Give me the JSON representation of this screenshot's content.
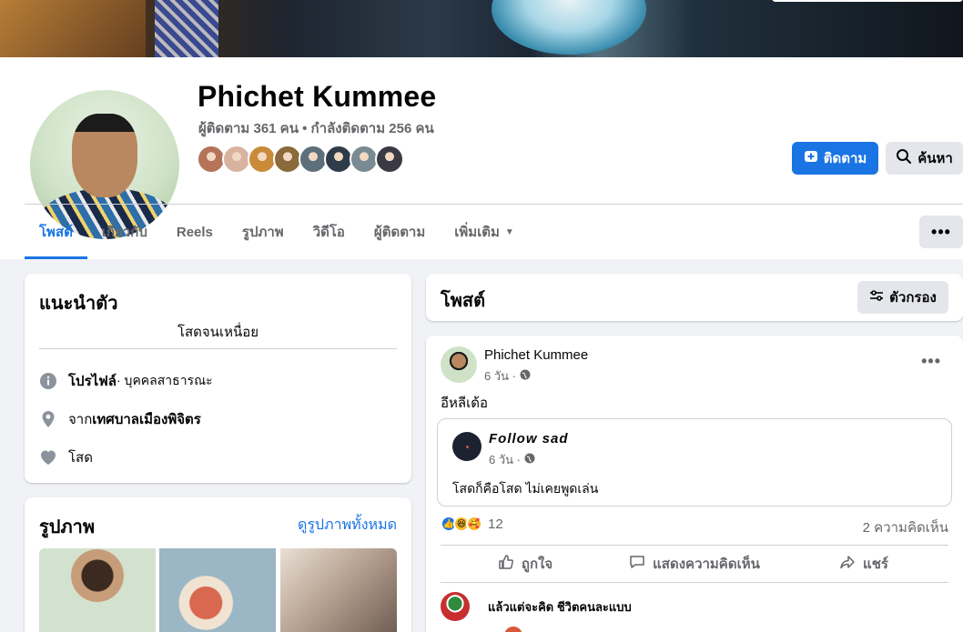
{
  "profile": {
    "name": "Phichet Kummee",
    "follow_stats": "ผู้ติดตาม 361 คน • กำลังติดตาม 256 คน",
    "friend_avatar_colors": [
      "#b5735a",
      "#d7b3a0",
      "#c98a3a",
      "#8a6a3a",
      "#5c6f7a",
      "#2e3c4a",
      "#7a8a92",
      "#3a3a44"
    ]
  },
  "header_buttons": {
    "follow_label": "ติดตาม",
    "search_label": "ค้นหา"
  },
  "tabs": [
    {
      "label": "โพสต์",
      "active": true
    },
    {
      "label": "เกี่ยวกับ"
    },
    {
      "label": "Reels"
    },
    {
      "label": "รูปภาพ"
    },
    {
      "label": "วิดีโอ"
    },
    {
      "label": "ผู้ติดตาม"
    },
    {
      "label": "เพิ่มเติม"
    }
  ],
  "intro": {
    "title": "แนะนำตัว",
    "bio": "โสดจนเหนื่อย",
    "profile_label": "โปรไฟล์",
    "profile_type": " · บุคคลสาธารณะ",
    "from_prefix": "จาก ",
    "hometown": "เทศบาลเมืองพิจิตร",
    "relationship": "โสด"
  },
  "photos": {
    "title": "รูปภาพ",
    "see_all": "ดูรูปภาพทั้งหมด"
  },
  "posts_section": {
    "title": "โพสต์",
    "filter_label": "ตัวกรอง"
  },
  "post": {
    "author": "Phichet Kummee",
    "time": "6 วัน ·",
    "text": "อีหลีเด้อ",
    "shared": {
      "author": "Follow sad",
      "time": "6 วัน ·",
      "text": "โสดก็คือโสด ไม่เคยพูดเล่น"
    },
    "reaction_count": "12",
    "comment_count": "2 ความคิดเห็น",
    "actions": {
      "like": "ถูกใจ",
      "comment": "แสดงความคิดเห็น",
      "share": "แชร์"
    },
    "first_comment": "แล้วแต่จะคิด ชีวิตคนละแบบ"
  },
  "colors": {
    "accent": "#1b74e4",
    "muted_text": "#65676b",
    "background": "#f0f2f5"
  }
}
